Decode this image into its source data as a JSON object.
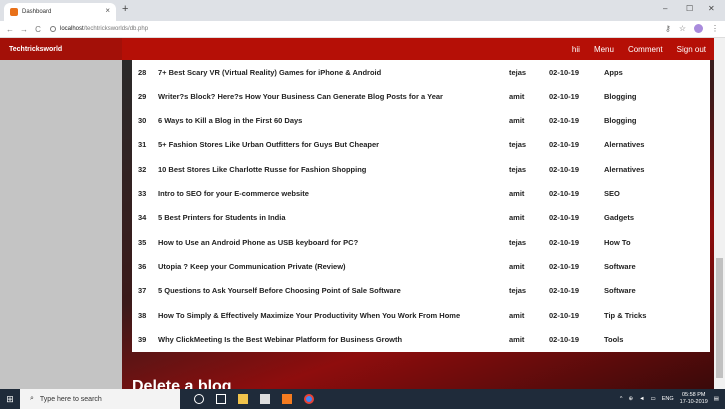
{
  "browser": {
    "tab_title": "Dashboard",
    "tab_close": "×",
    "new_tab": "+",
    "url_host": "localhost",
    "url_path": "/techtricksworlds/db.php",
    "win_min": "–",
    "win_max": "☐",
    "win_close": "✕"
  },
  "navbar": {
    "brand": "Techtricksworld",
    "links": [
      "hii",
      "Menu",
      "Comment",
      "Sign out"
    ]
  },
  "section_title": "Delete a blog",
  "rows": [
    {
      "id": "28",
      "title": "7+ Best Scary VR (Virtual Reality) Games for iPhone & Android",
      "author": "tejas",
      "date": "02-10-19",
      "category": "Apps"
    },
    {
      "id": "29",
      "title": "Writer?s Block? Here?s How Your Business Can Generate Blog Posts for a Year",
      "author": "amit",
      "date": "02-10-19",
      "category": "Blogging"
    },
    {
      "id": "30",
      "title": "6 Ways to Kill a Blog in the First 60 Days",
      "author": "amit",
      "date": "02-10-19",
      "category": "Blogging"
    },
    {
      "id": "31",
      "title": "5+ Fashion Stores Like Urban Outfitters for Guys But Cheaper",
      "author": "tejas",
      "date": "02-10-19",
      "category": "Alernatives"
    },
    {
      "id": "32",
      "title": "10 Best Stores Like Charlotte Russe for Fashion Shopping",
      "author": "tejas",
      "date": "02-10-19",
      "category": "Alernatives"
    },
    {
      "id": "33",
      "title": "Intro to SEO for your E-commerce website",
      "author": "amit",
      "date": "02-10-19",
      "category": "SEO"
    },
    {
      "id": "34",
      "title": "5 Best Printers for Students in India",
      "author": "amit",
      "date": "02-10-19",
      "category": "Gadgets"
    },
    {
      "id": "35",
      "title": "How to Use an Android Phone as USB keyboard for PC?",
      "author": "tejas",
      "date": "02-10-19",
      "category": "How To"
    },
    {
      "id": "36",
      "title": "Utopia ? Keep your Communication Private (Review)",
      "author": "amit",
      "date": "02-10-19",
      "category": "Software"
    },
    {
      "id": "37",
      "title": "5 Questions to Ask Yourself Before Choosing Point of Sale Software",
      "author": "tejas",
      "date": "02-10-19",
      "category": "Software"
    },
    {
      "id": "38",
      "title": "How To Simply & Effectively Maximize Your Productivity When You Work From Home",
      "author": "amit",
      "date": "02-10-19",
      "category": "Tip & Tricks"
    },
    {
      "id": "39",
      "title": "Why ClickMeeting Is the Best Webinar Platform for Business Growth",
      "author": "amit",
      "date": "02-10-19",
      "category": "Tools"
    }
  ],
  "taskbar": {
    "search_placeholder": "Type here to search",
    "lang": "ENG",
    "time": "05:58 PM",
    "date": "17-10-2019"
  },
  "colors": {
    "navbar": "#b50f06",
    "brand_bg": "#a31008",
    "taskbar": "#1f2b3a"
  }
}
